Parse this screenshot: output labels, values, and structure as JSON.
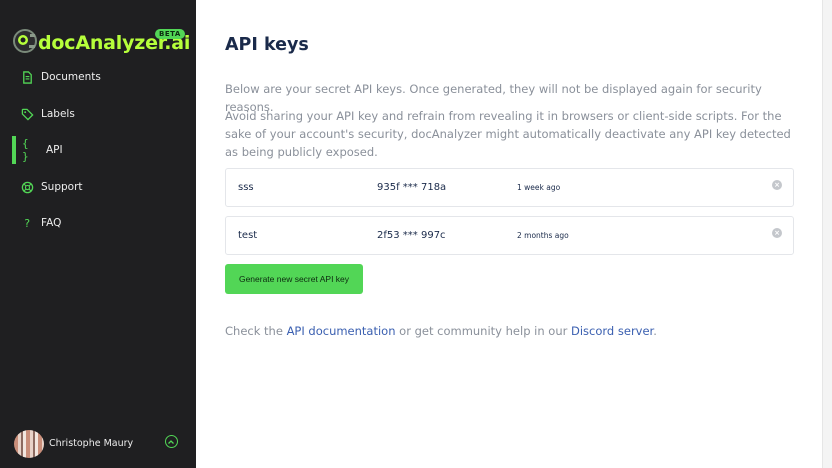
{
  "sidebar": {
    "brand": "docAnalyzer.ai",
    "badge": "BETA",
    "items": [
      {
        "label": "Documents",
        "icon": "document-icon",
        "active": false
      },
      {
        "label": "Labels",
        "icon": "tag-icon",
        "active": false
      },
      {
        "label": "API",
        "icon": "braces-icon",
        "active": true
      },
      {
        "label": "Support",
        "icon": "lifebuoy-icon",
        "active": false
      },
      {
        "label": "FAQ",
        "icon": "question-icon",
        "active": false
      }
    ],
    "user": {
      "name": "Christophe Maury"
    }
  },
  "main": {
    "title": "API keys",
    "description1": "Below are your secret API keys. Once generated, they will not be displayed again for security reasons.",
    "description2": "Avoid sharing your API key and refrain from revealing it in browsers or client-side scripts. For the sake of your account's security, docAnalyzer might automatically deactivate any API key detected as being publicly exposed.",
    "keys": [
      {
        "name": "sss",
        "value": "935f *** 718a",
        "created": "1 week ago"
      },
      {
        "name": "test",
        "value": "2f53 *** 997c",
        "created": "2 months ago"
      }
    ],
    "generate_label": "Generate new secret API key",
    "help": {
      "prefix": "Check the ",
      "docs_link": "API documentation",
      "middle": " or get community help in our ",
      "discord_link": "Discord server",
      "suffix": "."
    }
  },
  "colors": {
    "accent": "#52d656",
    "brand_text": "#b6ff3b",
    "sidebar_bg": "#1f1f21",
    "title": "#1a2a4a",
    "muted": "#8a909a",
    "link": "#3a5fb0"
  }
}
